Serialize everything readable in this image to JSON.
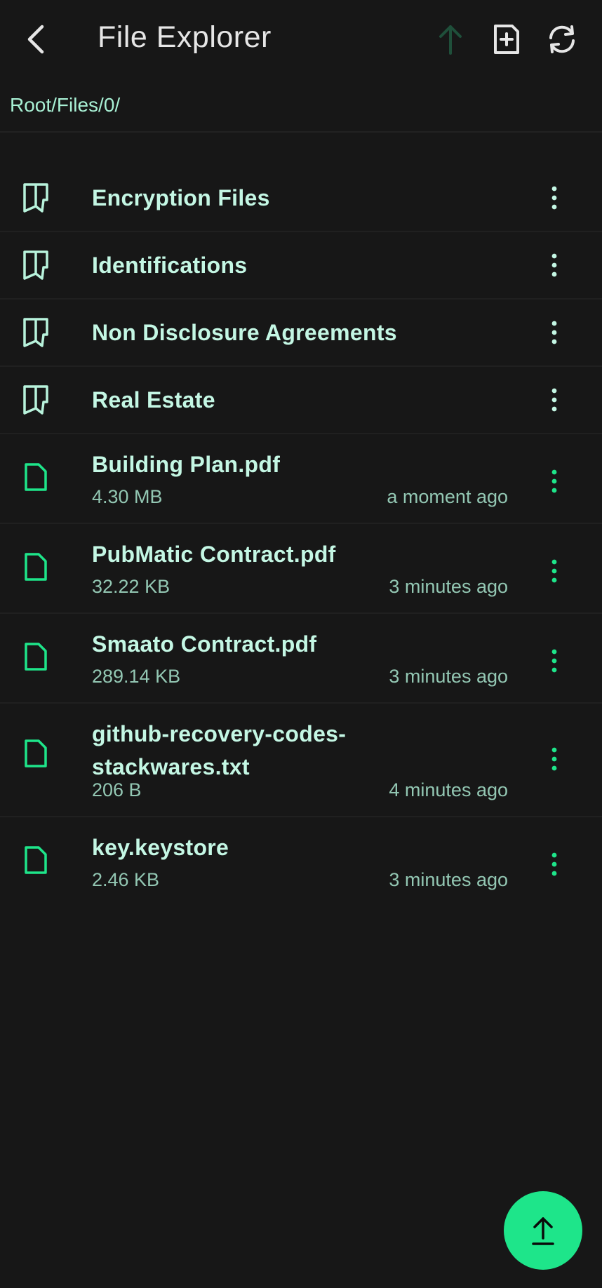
{
  "appbar": {
    "title": "File Explorer",
    "icons": {
      "back": "back-arrow-icon",
      "upload": "upload-arrow-icon",
      "new_file": "new-file-icon",
      "refresh": "refresh-icon"
    }
  },
  "breadcrumb": "Root/Files/0/",
  "folders": [
    {
      "name": "Encryption Files"
    },
    {
      "name": "Identifications"
    },
    {
      "name": "Non Disclosure Agreements"
    },
    {
      "name": "Real Estate"
    }
  ],
  "files": [
    {
      "name": "Building Plan.pdf",
      "size": "4.30 MB",
      "modified": "a moment ago"
    },
    {
      "name": "PubMatic Contract.pdf",
      "size": "32.22 KB",
      "modified": "3 minutes ago"
    },
    {
      "name": "Smaato Contract.pdf",
      "size": "289.14 KB",
      "modified": "3 minutes ago"
    },
    {
      "name": "github-recovery-codes-stackwares.txt",
      "size": "206 B",
      "modified": "4 minutes ago"
    },
    {
      "name": "key.keystore",
      "size": "2.46 KB",
      "modified": "3 minutes ago"
    }
  ],
  "fab": {
    "icon": "upload-icon"
  },
  "colors": {
    "background": "#171717",
    "accent": "#1ee58a",
    "folder_icon": "#b8f3dc",
    "text_primary": "#c4f7e4",
    "text_secondary": "#93c7b3",
    "disabled_upload": "#1f4f3a"
  }
}
